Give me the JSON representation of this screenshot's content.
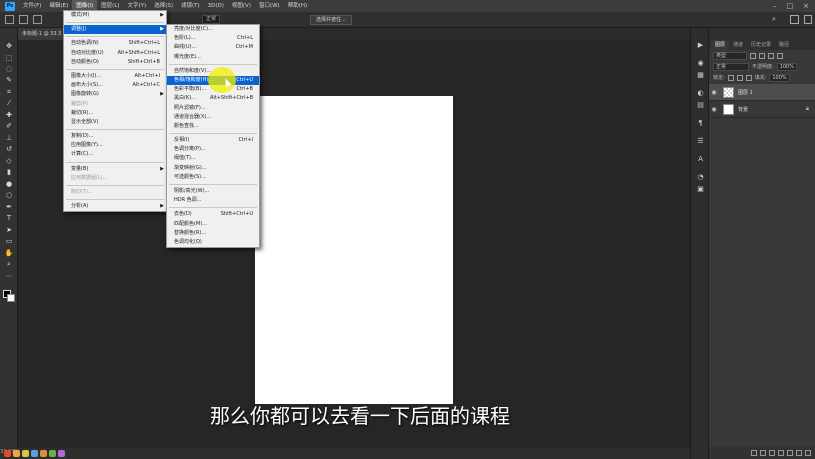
{
  "menubar": {
    "items": [
      "文件(F)",
      "编辑(E)",
      "图像(I)",
      "图层(L)",
      "文字(Y)",
      "选择(S)",
      "滤镜(T)",
      "3D(D)",
      "视图(V)",
      "窗口(W)",
      "帮助(H)"
    ]
  },
  "optionsbar": {
    "style_value": "正常",
    "select_mask": "选择并遮住..."
  },
  "document_tab": "未标题-1 @ 33.3",
  "image_menu": {
    "mode": "模式(M)",
    "adjustments": "调整(J)",
    "auto_tone": "自动色调(N)",
    "auto_tone_sc": "Shift+Ctrl+L",
    "auto_contrast": "自动对比度(U)",
    "auto_contrast_sc": "Alt+Shift+Ctrl+L",
    "auto_color": "自动颜色(O)",
    "auto_color_sc": "Shift+Ctrl+B",
    "image_size": "图像大小(I)...",
    "image_size_sc": "Alt+Ctrl+I",
    "canvas_size": "画布大小(S)...",
    "canvas_size_sc": "Alt+Ctrl+C",
    "rotation": "图像旋转(G)",
    "crop": "裁剪(P)",
    "trim": "裁切(R)...",
    "reveal_all": "显示全部(V)",
    "duplicate": "复制(D)...",
    "apply_image": "应用图像(Y)...",
    "calculations": "计算(C)...",
    "variables": "变量(B)",
    "apply_dataset": "应用数据组(L)...",
    "trap": "陷印(T)...",
    "analysis": "分析(A)"
  },
  "adjust_menu": {
    "brightness": "亮度/对比度(C)...",
    "levels": "色阶(L)...",
    "levels_sc": "Ctrl+L",
    "curves": "曲线(U)...",
    "curves_sc": "Ctrl+M",
    "exposure": "曝光度(E)...",
    "vibrance": "自然饱和度(V)...",
    "hue_sat": "色相/饱和度(H)...",
    "hue_sat_sc": "Ctrl+U",
    "color_balance": "色彩平衡(B)...",
    "color_balance_sc": "Ctrl+B",
    "bw": "黑白(K)...",
    "bw_sc": "Alt+Shift+Ctrl+B",
    "photo_filter": "照片滤镜(F)...",
    "channel_mixer": "通道混合器(X)...",
    "color_lookup": "颜色查找...",
    "invert": "反相(I)",
    "invert_sc": "Ctrl+I",
    "posterize": "色调分离(P)...",
    "threshold": "阈值(T)...",
    "gradient_map": "渐变映射(G)...",
    "selective_color": "可选颜色(S)...",
    "shadows_highlights": "阴影/高光(W)...",
    "hdr_toning": "HDR 色调...",
    "desaturate": "去色(D)",
    "desaturate_sc": "Shift+Ctrl+U",
    "match_color": "匹配颜色(M)...",
    "replace_color": "替换颜色(R)...",
    "equalize": "色调均化(Q)"
  },
  "layers_panel": {
    "tabs": [
      "图层",
      "通道",
      "历史记录",
      "路径"
    ],
    "filter_kind": "类型",
    "blend_mode": "正常",
    "opacity_label": "不透明度:",
    "opacity_value": "100%",
    "lock_label": "锁定:",
    "fill_label": "填充:",
    "fill_value": "100%",
    "layers": [
      "图层 1",
      "背景"
    ]
  },
  "subtitle": "那么你都可以去看一下后面的课程",
  "status": {
    "zoom": "33.33%"
  },
  "accent_colors": {
    "menu_highlight": "#0a64d0",
    "ps_logo": "#31a8ff",
    "cursor_highlight": "#f0f000"
  }
}
